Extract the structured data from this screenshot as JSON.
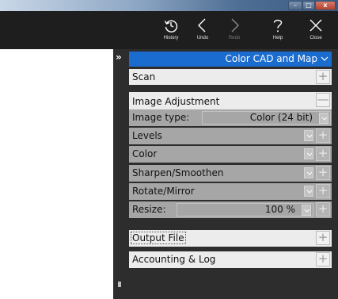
{
  "window": {
    "minimize_glyph": "–",
    "maximize_glyph": "□",
    "close_glyph": "x"
  },
  "toolbar": {
    "items": [
      {
        "label": "History",
        "icon": "history-icon",
        "enabled": true
      },
      {
        "label": "Undo",
        "icon": "undo-icon",
        "enabled": true
      },
      {
        "label": "Redo",
        "icon": "redo-icon",
        "enabled": false
      },
      {
        "label": "Help",
        "icon": "help-icon",
        "enabled": true
      },
      {
        "label": "Close",
        "icon": "close-icon",
        "enabled": true
      }
    ]
  },
  "panel": {
    "collapse_glyph": "»",
    "header_title": "Color CAD and Map",
    "colors": {
      "header_blue": "#1a6ccf",
      "panel_dark": "#2d2d2d",
      "section_light": "#ececec",
      "section_disabled": "#a6a6a6"
    },
    "sections": {
      "scan": {
        "label": "Scan",
        "toggle": "+"
      },
      "image_adjustment": {
        "label": "Image Adjustment",
        "toggle": "—"
      },
      "image_type": {
        "label": "Image type:",
        "value": "Color (24 bit)"
      },
      "levels": {
        "label": "Levels",
        "toggle": "+"
      },
      "color": {
        "label": "Color",
        "toggle": "+"
      },
      "sharpen": {
        "label": "Sharpen/Smoothen",
        "toggle": "+"
      },
      "rotate": {
        "label": "Rotate/Mirror",
        "toggle": "+"
      },
      "resize": {
        "label": "Resize:",
        "value": "100 %",
        "toggle": "+"
      },
      "output_file": {
        "label": "Output File",
        "toggle": "+"
      },
      "accounting": {
        "label": "Accounting & Log",
        "toggle": "+"
      }
    }
  }
}
